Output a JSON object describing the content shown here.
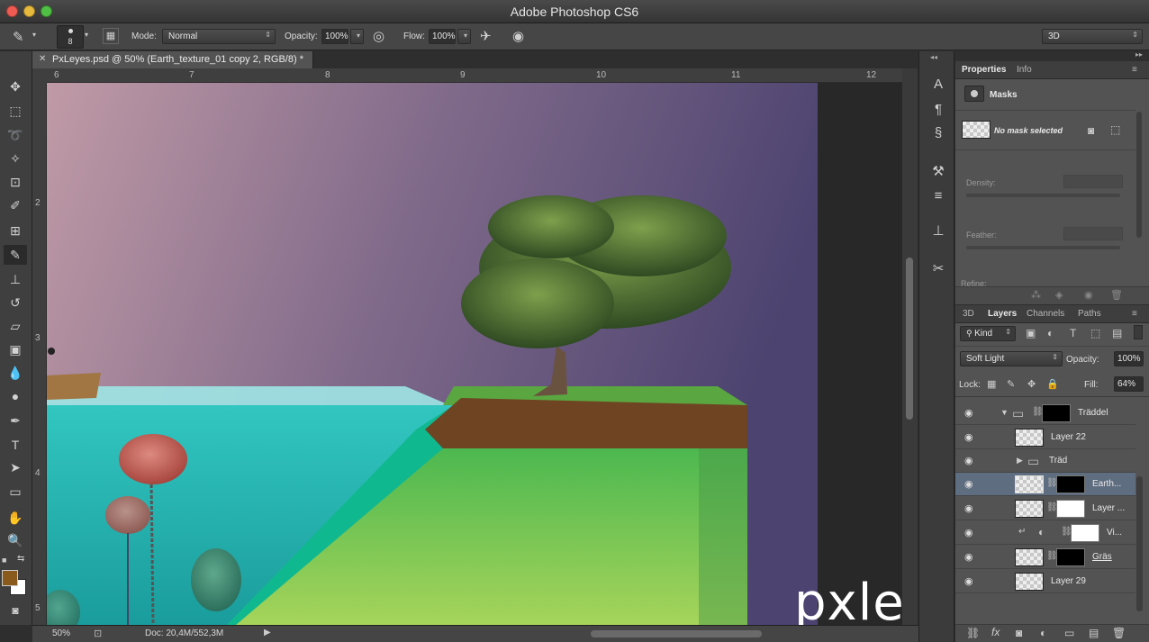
{
  "app": {
    "title": "Adobe Photoshop CS6"
  },
  "options": {
    "brush_size": "8",
    "mode_label": "Mode:",
    "mode_value": "Normal",
    "opacity_label": "Opacity:",
    "opacity_value": "100%",
    "flow_label": "Flow:",
    "flow_value": "100%",
    "workspace": "3D"
  },
  "document": {
    "tab_title": "PxLeyes.psd @ 50% (Earth_texture_01 copy 2, RGB/8) *"
  },
  "rulers": {
    "top": [
      "6",
      "7",
      "8",
      "9",
      "10",
      "11",
      "12"
    ],
    "left": [
      "2",
      "3",
      "4",
      "5"
    ]
  },
  "status": {
    "zoom": "50%",
    "doc": "Doc: 20,4M/552,3M"
  },
  "colors": {
    "foreground": "#8a5a1c",
    "background": "#ffffff"
  },
  "properties": {
    "tabs": [
      "Properties",
      "Info"
    ],
    "section": "Masks",
    "mask_state": "No mask selected",
    "density_label": "Density:",
    "feather_label": "Feather:",
    "refine_label": "Refine:"
  },
  "layers": {
    "tabs": [
      "3D",
      "Layers",
      "Channels",
      "Paths"
    ],
    "filter": "Kind",
    "blend_mode": "Soft Light",
    "opacity_label": "Opacity:",
    "opacity_value": "100%",
    "lock_label": "Lock:",
    "fill_label": "Fill:",
    "fill_value": "64%",
    "items": [
      {
        "name": "Träddel"
      },
      {
        "name": "Layer 22"
      },
      {
        "name": "Träd"
      },
      {
        "name": "Earth..."
      },
      {
        "name": "Layer ..."
      },
      {
        "name": "Vi..."
      },
      {
        "name": "Gräs"
      },
      {
        "name": "Layer 29"
      }
    ]
  },
  "watermark": "pxleyes.com"
}
